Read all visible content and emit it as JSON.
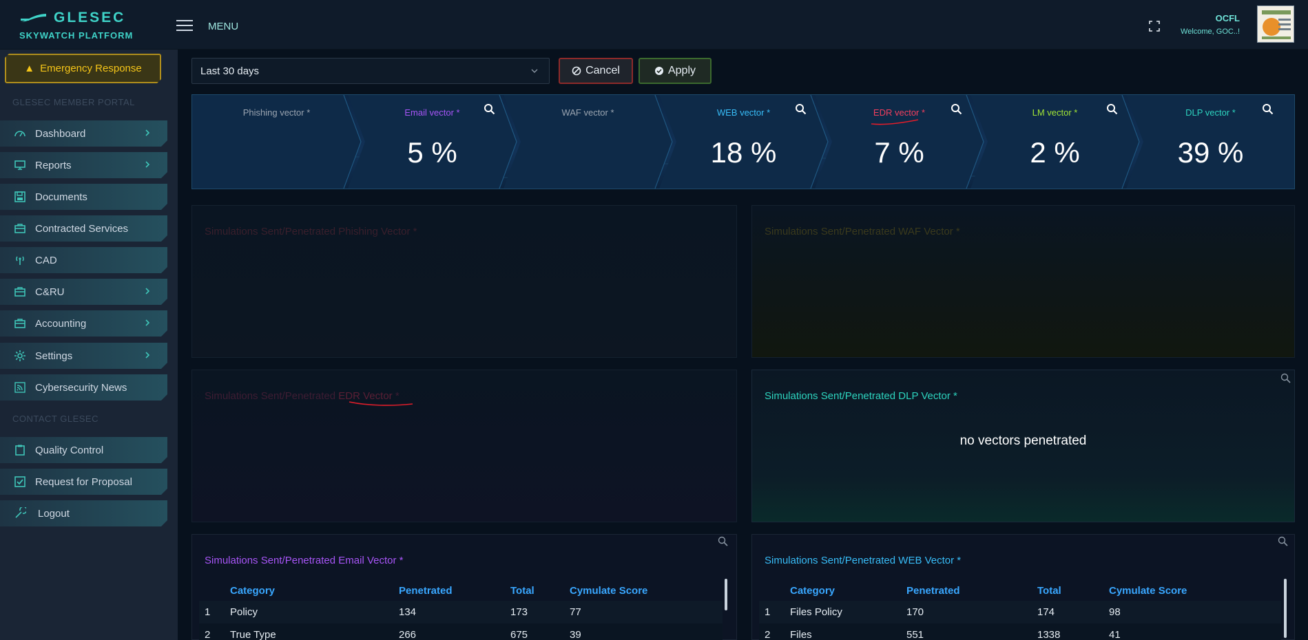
{
  "brand": {
    "name": "GLESEC",
    "platform": "SKYWATCH PLATFORM"
  },
  "header": {
    "menu_label": "MENU",
    "org_name": "OCFL",
    "welcome": "Welcome, GOC..!"
  },
  "sidebar": {
    "emergency_label": "Emergency Response",
    "member_portal_label": "GLESEC MEMBER PORTAL",
    "contact_label": "CONTACT GLESEC",
    "items": [
      {
        "label": "Dashboard",
        "icon": "dashboard-icon"
      },
      {
        "label": "Reports",
        "icon": "monitor-icon"
      },
      {
        "label": "Documents",
        "icon": "save-icon"
      },
      {
        "label": "Contracted Services",
        "icon": "briefcase-icon"
      },
      {
        "label": "CAD",
        "icon": "antenna-icon"
      },
      {
        "label": "C&RU",
        "icon": "briefcase-icon"
      },
      {
        "label": "Accounting",
        "icon": "briefcase-icon"
      },
      {
        "label": "Settings",
        "icon": "gear-icon"
      },
      {
        "label": "Cybersecurity News",
        "icon": "rss-icon"
      }
    ],
    "contact_items": [
      {
        "label": "Quality Control",
        "icon": "clipboard-icon"
      },
      {
        "label": "Request for Proposal",
        "icon": "checkbox-icon"
      },
      {
        "label": "Logout",
        "icon": "logout-icon"
      }
    ]
  },
  "filters": {
    "range_value": "Last 30 days",
    "cancel_label": "Cancel",
    "apply_label": "Apply"
  },
  "vectors": [
    {
      "label": "Phishing vector *",
      "value": "",
      "color": "#9aa4b0"
    },
    {
      "label": "Email vector *",
      "value": "5 %",
      "color": "#a855f7"
    },
    {
      "label": "WAF vector *",
      "value": "",
      "color": "#9aa4b0"
    },
    {
      "label": "WEB vector *",
      "value": "18 %",
      "color": "#38bdf8"
    },
    {
      "label": "EDR vector *",
      "value": "7 %",
      "color": "#f43f5e"
    },
    {
      "label": "LM vector *",
      "value": "2 %",
      "color": "#a3e635"
    },
    {
      "label": "DLP vector *",
      "value": "39 %",
      "color": "#2dd4bf"
    }
  ],
  "panels": {
    "phishing_title": "Simulations Sent/Penetrated Phishing Vector *",
    "waf_title": "Simulations Sent/Penetrated WAF Vector *",
    "edr_title_prefix": "Simulations Sent/Penetrated ",
    "edr_title_highlight": "EDR Vector",
    "edr_title_suffix": " *",
    "dlp_title": "Simulations Sent/Penetrated DLP Vector *",
    "dlp_message": "no vectors penetrated",
    "email_title": "Simulations Sent/Penetrated Email Vector *",
    "web_title": "Simulations Sent/Penetrated WEB Vector *"
  },
  "email_table": {
    "headers": [
      "",
      "Category",
      "Penetrated",
      "Total",
      "Cymulate Score"
    ],
    "rows": [
      [
        "1",
        "Policy",
        "134",
        "173",
        "77"
      ],
      [
        "2",
        "True Type",
        "266",
        "675",
        "39"
      ]
    ]
  },
  "web_table": {
    "headers": [
      "",
      "Category",
      "Penetrated",
      "Total",
      "Cymulate Score"
    ],
    "rows": [
      [
        "1",
        "Files Policy",
        "170",
        "174",
        "98"
      ],
      [
        "2",
        "Files",
        "551",
        "1338",
        "41"
      ]
    ]
  },
  "colors": {
    "accent": "#3fd3c8",
    "table_header": "#39a7ff",
    "annotation": "#e11d2a"
  }
}
